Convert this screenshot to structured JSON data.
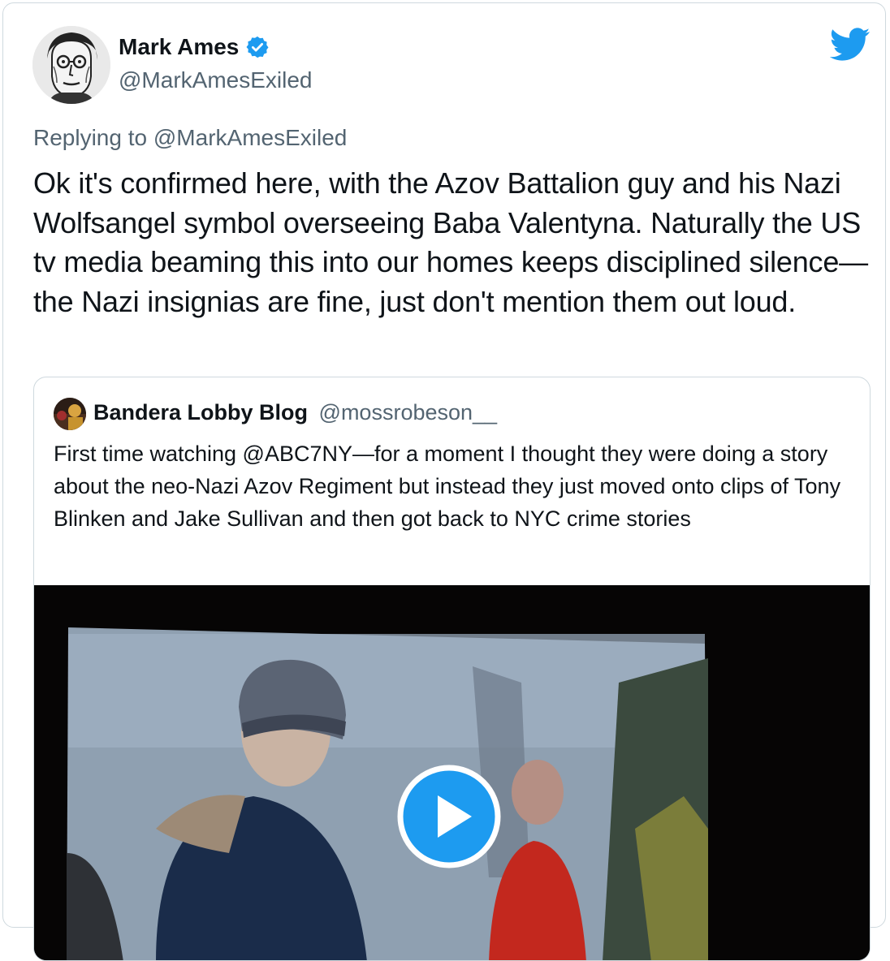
{
  "tweet": {
    "author_name": "Mark Ames",
    "author_handle": "@MarkAmesExiled",
    "replying_prefix": "Replying to",
    "replying_to": "@MarkAmesExiled",
    "text": "Ok it's confirmed here, with the Azov Battalion guy and his Nazi Wolfsangel symbol overseeing Baba Valentyna. Naturally the US tv media beaming this into our homes keeps disciplined silence—the Nazi insignias are fine, just don't mention them out loud."
  },
  "quoted_tweet": {
    "author_name": "Bandera Lobby Blog",
    "author_handle": "@mossrobeson__",
    "text": "First time watching @ABC7NY—for a moment I thought they were doing a story about the neo-Nazi Azov Regiment but instead they just moved onto clips of Tony Blinken and Jake Sullivan and then got back to NYC crime stories",
    "media": {
      "type": "video",
      "play_icon": "play-icon"
    }
  },
  "icons": {
    "verified": "verified-badge-icon",
    "brand": "twitter-bird-icon"
  },
  "colors": {
    "accent": "#1d9bf0",
    "text_primary": "#0f1419",
    "text_secondary": "#536471",
    "border": "#cfd9de"
  }
}
